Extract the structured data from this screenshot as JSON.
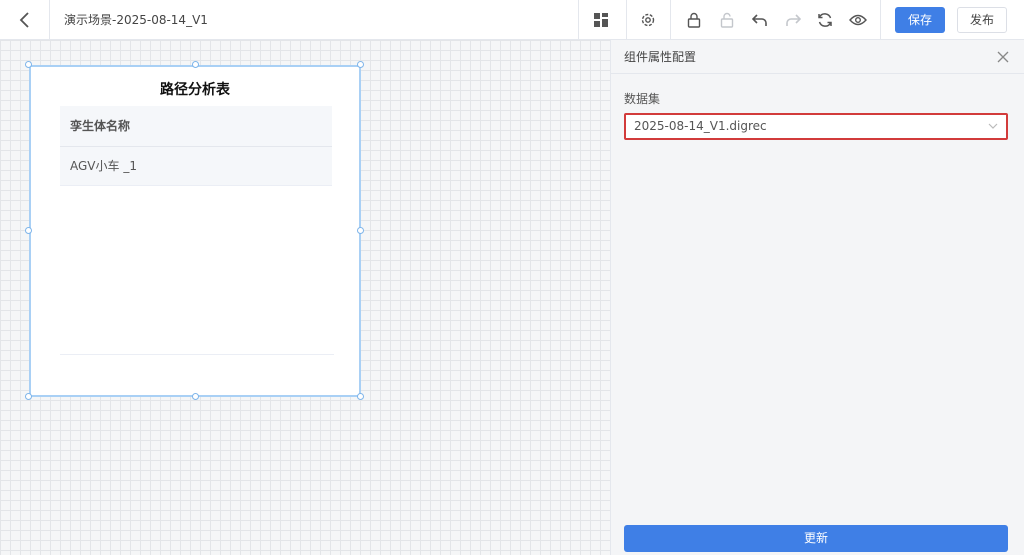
{
  "header": {
    "scene_title": "演示场景-2025-08-14_V1",
    "save_label": "保存",
    "publish_label": "发布",
    "icons": [
      "back-arrow-icon",
      "layout-grid-icon",
      "settings-icon",
      "lock-icon",
      "unlock-icon",
      "undo-icon",
      "redo-icon",
      "refresh-icon",
      "preview-eye-icon"
    ]
  },
  "widget": {
    "title": "路径分析表",
    "table": {
      "column_header": "孪生体名称",
      "rows": [
        "AGV小车 _1"
      ]
    }
  },
  "panel": {
    "title": "组件属性配置",
    "dataset_label": "数据集",
    "dataset_value": "2025-08-14_V1.digrec",
    "update_label": "更新"
  },
  "colors": {
    "primary": "#3f7fe6",
    "highlight_border": "#d23b3b",
    "selection_border": "#a9d0f5"
  }
}
